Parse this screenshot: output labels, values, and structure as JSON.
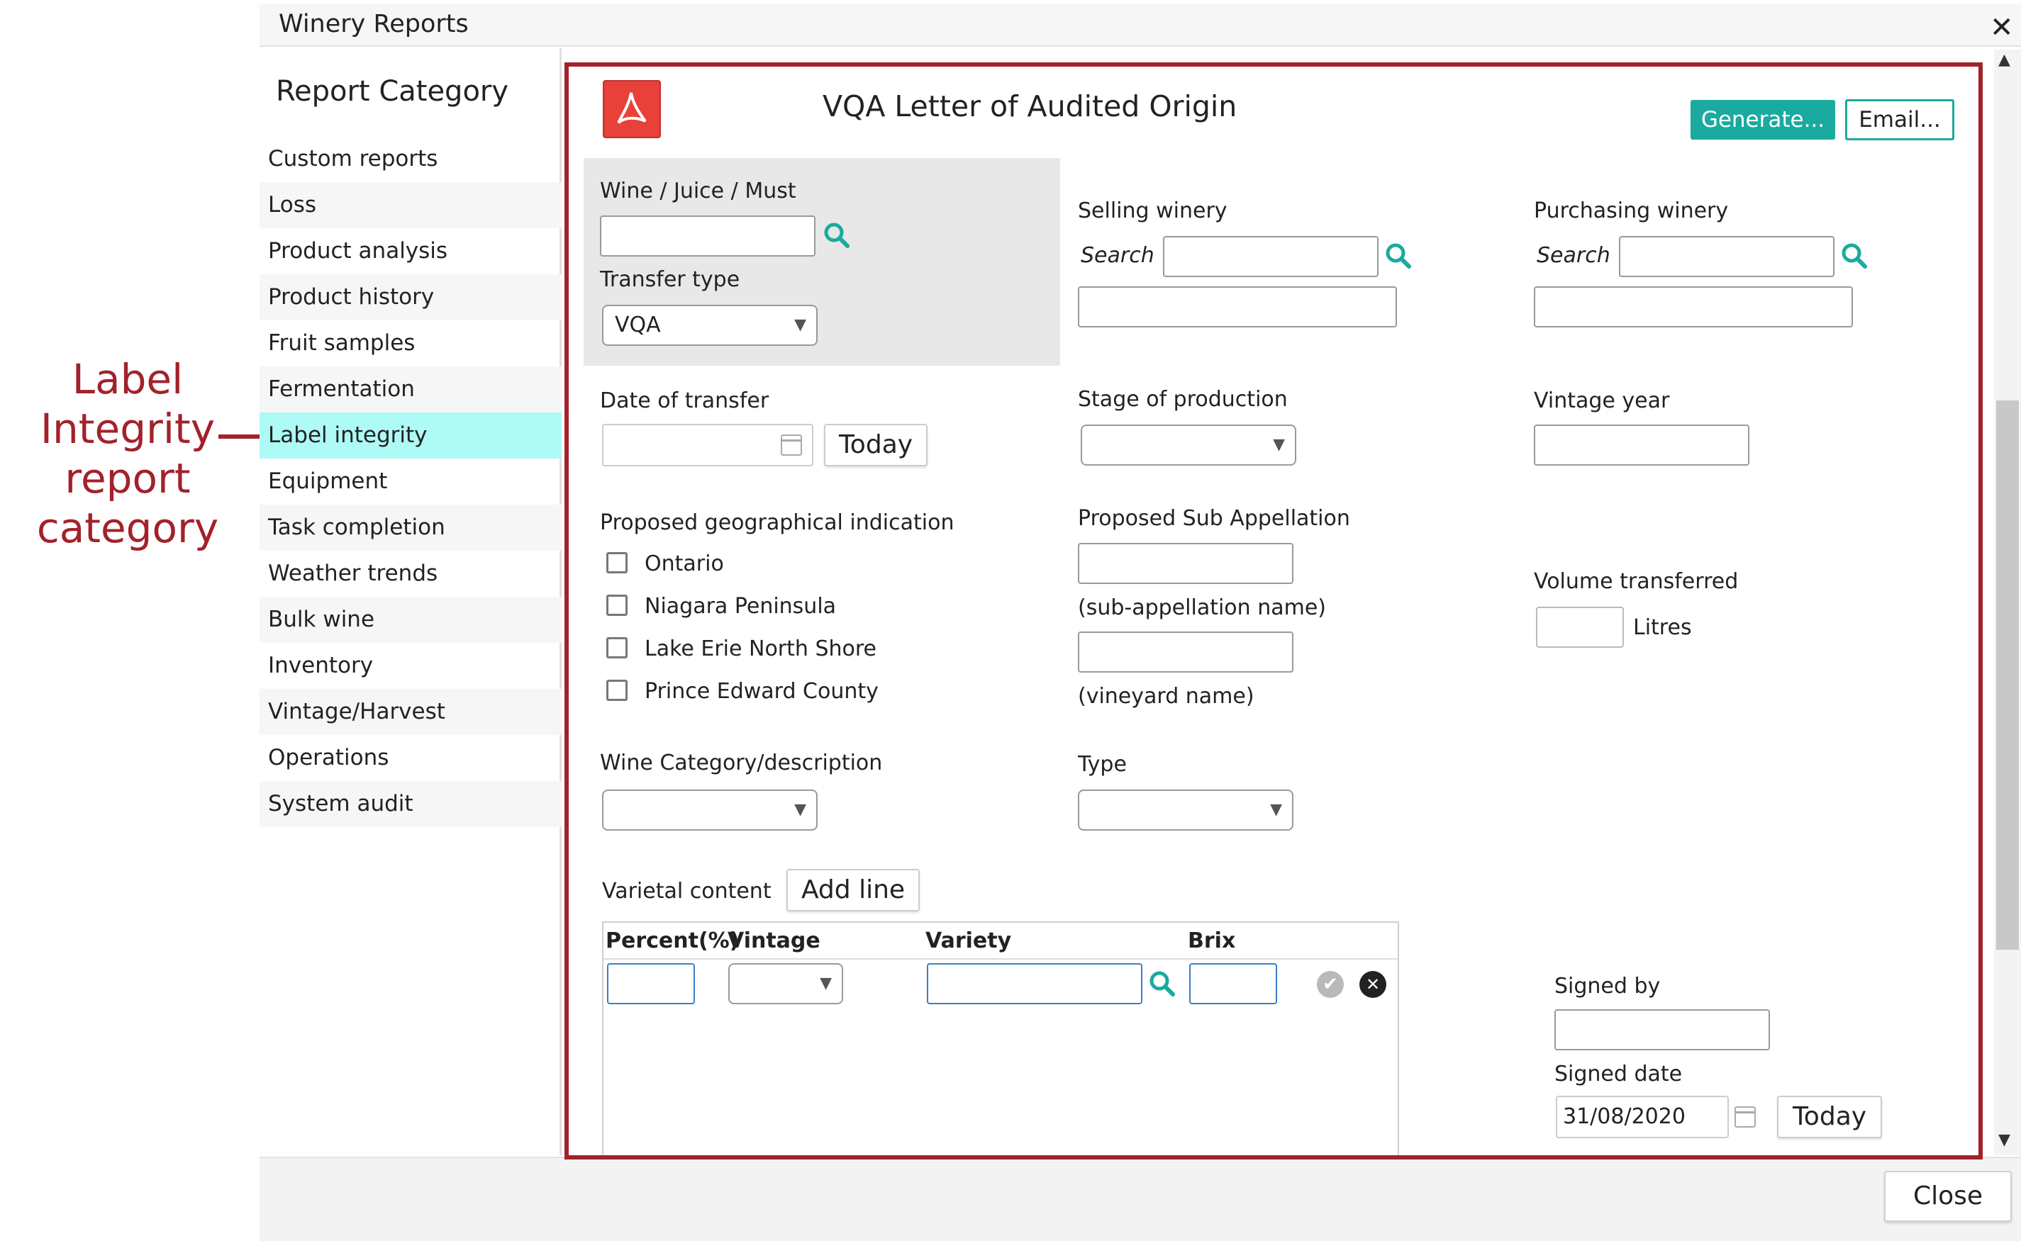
{
  "annotation": {
    "line1": "Label",
    "line2": "Integrity",
    "line3": "report",
    "line4": "category"
  },
  "window": {
    "title": "Winery Reports",
    "close_label": "✕"
  },
  "sidebar": {
    "heading": "Report Category",
    "items": [
      {
        "label": "Custom reports"
      },
      {
        "label": "Loss"
      },
      {
        "label": "Product analysis"
      },
      {
        "label": "Product history"
      },
      {
        "label": "Fruit samples"
      },
      {
        "label": "Fermentation"
      },
      {
        "label": "Label integrity",
        "selected": true
      },
      {
        "label": "Equipment"
      },
      {
        "label": "Task completion"
      },
      {
        "label": "Weather trends"
      },
      {
        "label": "Bulk wine"
      },
      {
        "label": "Inventory"
      },
      {
        "label": "Vintage/Harvest"
      },
      {
        "label": "Operations"
      },
      {
        "label": "System audit"
      }
    ]
  },
  "report": {
    "title": "VQA Letter of Audited Origin",
    "generate_label": "Generate...",
    "email_label": "Email...",
    "wine_juice_must_label": "Wine / Juice / Must",
    "transfer_type_label": "Transfer type",
    "transfer_type_value": "VQA",
    "selling_winery_label": "Selling winery",
    "purchasing_winery_label": "Purchasing winery",
    "search_label": "Search",
    "date_of_transfer_label": "Date of transfer",
    "today_label": "Today",
    "stage_of_production_label": "Stage of production",
    "vintage_year_label": "Vintage year",
    "geo_indication_label": "Proposed geographical indication",
    "geo_options": [
      "Ontario",
      "Niagara Peninsula",
      "Lake Erie North Shore",
      "Prince Edward County"
    ],
    "sub_appellation_label": "Proposed Sub Appellation",
    "sub_appellation_name_hint": "(sub-appellation name)",
    "vineyard_name_hint": "(vineyard name)",
    "volume_transferred_label": "Volume transferred",
    "litres_label": "Litres",
    "wine_category_label": "Wine Category/description",
    "type_label": "Type",
    "varietal_content_label": "Varietal content",
    "add_line_label": "Add line",
    "table_headers": [
      "Percent(%)",
      "Vintage",
      "Variety",
      "Brix"
    ],
    "signed_by_label": "Signed by",
    "signed_date_label": "Signed date",
    "signed_date_value": "31/08/2020"
  },
  "footer": {
    "close_label": "Close"
  },
  "colors": {
    "accent_teal": "#1aaa9f",
    "selected_row": "#aefaf4",
    "highlight_red": "#a3212b",
    "pdf_red": "#e8413a"
  }
}
